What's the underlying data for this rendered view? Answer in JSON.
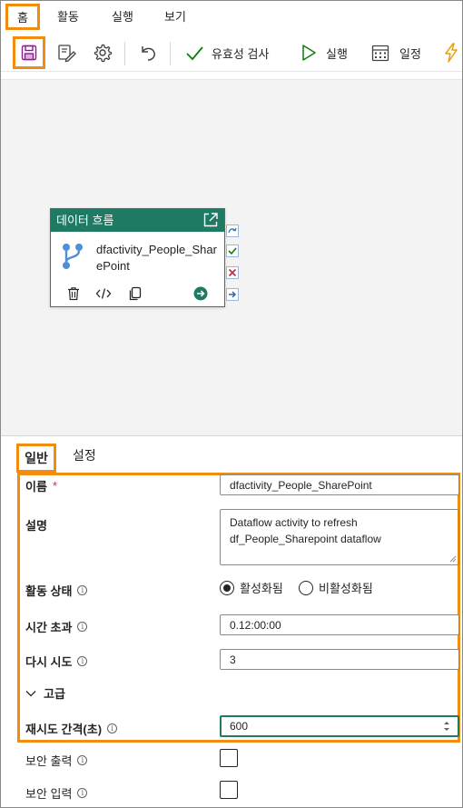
{
  "menu": {
    "home": "홈",
    "activity": "활동",
    "run": "실행",
    "view": "보기"
  },
  "toolbar": {
    "validate_label": "유효성 검사",
    "run_label": "실행",
    "schedule_label": "일정"
  },
  "colors": {
    "highlight": "#f28c0f",
    "card_header": "#1f7a64",
    "canvas_bg": "#f3f3f3"
  },
  "card": {
    "header": "데이터 흐름",
    "name": "dfactivity_People_SharePoint",
    "type_icon": "dataflow-icon"
  },
  "panel": {
    "tabs": [
      {
        "label": "일반",
        "selected": true
      },
      {
        "label": "설정",
        "selected": false
      }
    ],
    "name": {
      "label": "이름",
      "required_mark": "*",
      "value": "dfactivity_People_SharePoint"
    },
    "description": {
      "label": "설명",
      "value": "Dataflow activity to refresh df_People_Sharepoint dataflow"
    },
    "activity_state": {
      "label": "활동 상태",
      "options": [
        "활성화됨",
        "비활성화됨"
      ],
      "selected": "활성화됨"
    },
    "timeout": {
      "label": "시간 초과",
      "value": "0.12:00:00"
    },
    "retry": {
      "label": "다시 시도",
      "value": "3"
    },
    "advanced": {
      "label": "고급"
    },
    "retry_interval": {
      "label": "재시도 간격(초)",
      "value": "600"
    },
    "secure_output": {
      "label": "보안 출력",
      "checked": false
    },
    "secure_input": {
      "label": "보안 입력",
      "checked": false
    }
  }
}
